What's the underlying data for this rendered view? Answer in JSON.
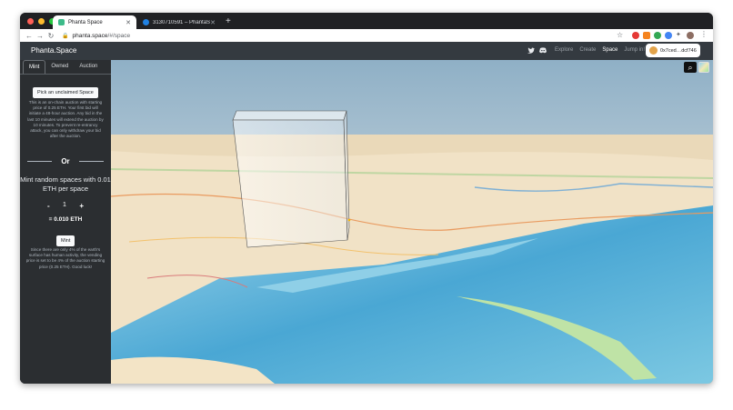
{
  "browser": {
    "tabs": [
      {
        "title": "Phanta Space",
        "active": true
      },
      {
        "title": "3130710591 – PhantaSpace",
        "active": false
      }
    ],
    "address": {
      "host": "phanta.space",
      "path": "/#/space"
    }
  },
  "app": {
    "brand": "Phanta.Space",
    "nav": [
      "Explore",
      "Create",
      "Space",
      "Jump in!"
    ],
    "active_nav": "Space",
    "wallet": "0x7ced…dcf746"
  },
  "sidebar": {
    "tabs": [
      "Mint",
      "Owned",
      "Auction"
    ],
    "active_tab": "Mint",
    "pick_button": "Pick an unclaimed Space",
    "auction_text": "This is an on-chain auction with starting price of 0.25 ETH. Your first bid will initiate a 48-hour auction. Any bid in the last 10 minutes will extend the auction by 10 minutes. To prevent re-entrancy attack, you can only withdraw your bid after the auction.",
    "or": "Or",
    "mint_heading": "Mint random spaces with 0.01 ETH per space",
    "stepper": {
      "minus": "-",
      "value": "1",
      "plus": "+"
    },
    "total": "= 0.010 ETH",
    "mint_button": "Mint",
    "footer_text": "Since there are only 4% of the earth's surface has human activity, the vending price is set to be 4% of the auction starting price (0.25 ETH). Good luck!"
  },
  "colors": {
    "accent": "#ffffff",
    "sidebar_bg": "#2b2e31",
    "appbar_bg": "#343a40",
    "water": "#5fb3d9",
    "land": "#f1e2c6"
  }
}
